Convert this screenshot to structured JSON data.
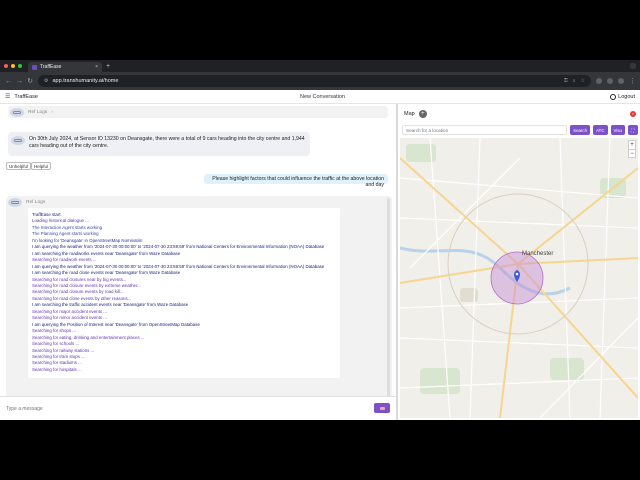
{
  "browser": {
    "tab_title": "TraffEase",
    "tab_close": "×",
    "new_tab": "+",
    "url": "app.transhumanity.ai/home",
    "nav_back": "←",
    "nav_forward": "→",
    "nav_reload": "↻",
    "traffic_lights": [
      "#ff5f57",
      "#febc2e",
      "#28c840"
    ]
  },
  "app": {
    "brand": "TraffEase",
    "menu_icon": "☰",
    "conversation_title": "New Conversation",
    "logout_label": "Logout"
  },
  "chat": {
    "ref_logs_label": "Ref Logs",
    "ref_logs_chevron": "›",
    "bot_message": "On 30th July 2024, at Sensor ID 13230 on Deansgate, there were a total of 9 cars heading into the city centre and 1,944 cars heading out of the city centre.",
    "feedback": [
      "Unhelpful",
      "Helpful"
    ],
    "user_message": "Please highlight factors that could influence the traffic at the above location and day",
    "ref_logs_label_2": "Ref Logs",
    "log_lines": [
      {
        "text": "TraffEase start",
        "color": "#1a237e"
      },
      {
        "text": "Loading historical dialogue ...",
        "color": "#5e35b1"
      },
      {
        "text": "The Interaction Agent starts working",
        "color": "#3949ab"
      },
      {
        "text": "The Planning Agent starts working",
        "color": "#3949ab"
      },
      {
        "text": "I'm looking for 'Deansgate' in OpenStreetMap Nominatim",
        "color": "#283593"
      },
      {
        "text": "I am querying the weather from '2024-07-30 00:00:00' to '2024-07-30 23:59:59' from National Centers for Environmental Information (NOAA) Database",
        "color": "#1a237e"
      },
      {
        "text": "I am searching the roadworks events near 'Deansgate' from Waze Database",
        "color": "#1a237e"
      },
      {
        "text": "Searching for roadwork events ...",
        "color": "#5e35b1"
      },
      {
        "text": "I am querying the weather from '2024-07-30 00:00:00' to '2024-07-30 23:59:59' from National Centers for Environmental Information (NOAA) Database",
        "color": "#1a237e"
      },
      {
        "text": "I am searching the road close events near 'Deansgate' from Waze Database",
        "color": "#1a237e"
      },
      {
        "text": "Searching for road closures near by big events...",
        "color": "#5e35b1"
      },
      {
        "text": "Searching for road closure events by extreme weather...",
        "color": "#5e35b1"
      },
      {
        "text": "Searching for road closure events by road kill...",
        "color": "#5e35b1"
      },
      {
        "text": "Searching for road close events by other reasons...",
        "color": "#5e35b1"
      },
      {
        "text": "I am searching the traffic accident events near 'Deansgate' from Waze Database",
        "color": "#1a237e"
      },
      {
        "text": "Searching for major accident events ...",
        "color": "#5e35b1"
      },
      {
        "text": "Searching for minor accident events ...",
        "color": "#5e35b1"
      },
      {
        "text": "I am querying the Position of Interest near 'Deansgate' from OpenStreetMap Database",
        "color": "#1a237e"
      },
      {
        "text": "Searching for shops ...",
        "color": "#5e35b1"
      },
      {
        "text": "Searching for eating, drinking and entertainment places ...",
        "color": "#5e35b1"
      },
      {
        "text": "Searching for schools ...",
        "color": "#5e35b1"
      },
      {
        "text": "Searching for railway stations ...",
        "color": "#5e35b1"
      },
      {
        "text": "Searching for tram stops ...",
        "color": "#5e35b1"
      },
      {
        "text": "Searching for stadiums ...",
        "color": "#5e35b1"
      },
      {
        "text": "Searching for hospitals ...",
        "color": "#5e35b1"
      }
    ],
    "composer_placeholder": "Type a message"
  },
  "map": {
    "title": "Map",
    "add_icon": "+",
    "close_icon": "×",
    "search_placeholder": "Search for a location",
    "buttons": [
      "Search",
      "ATC",
      "Visu"
    ],
    "zoom_in": "+",
    "zoom_out": "−",
    "city_label": "Manchester",
    "accent": "#7b52c7",
    "marker_color": "#3b5bdb",
    "highlight_color": "#c58ad8"
  }
}
